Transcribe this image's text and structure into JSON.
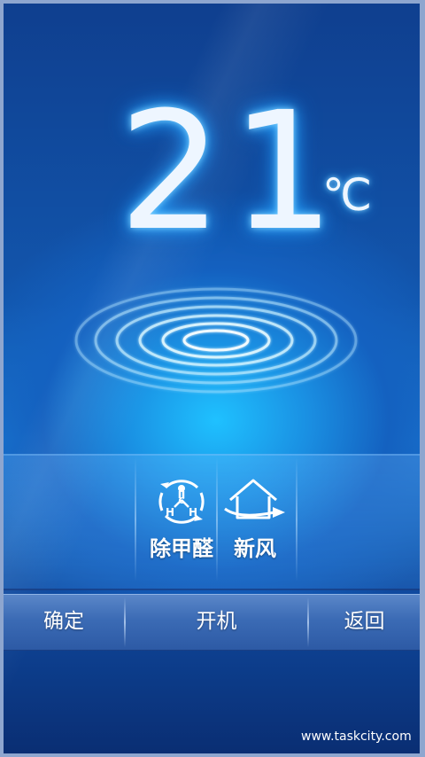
{
  "display": {
    "temperature": "21",
    "unit": "℃"
  },
  "functions": [
    {
      "label": "除甲醛",
      "icon": "formaldehyde-molecule-icon"
    },
    {
      "label": "新风",
      "icon": "fresh-air-house-icon"
    }
  ],
  "bottom_bar": {
    "confirm_label": "确定",
    "power_label": "开机",
    "back_label": "返回"
  },
  "watermark": "www.taskcity.com",
  "colors": {
    "background_top": "#0f3f8f",
    "background_glow": "#1fc1ff",
    "temperature_glow": "#2aa7ff",
    "bar": "#3b6bb5"
  }
}
